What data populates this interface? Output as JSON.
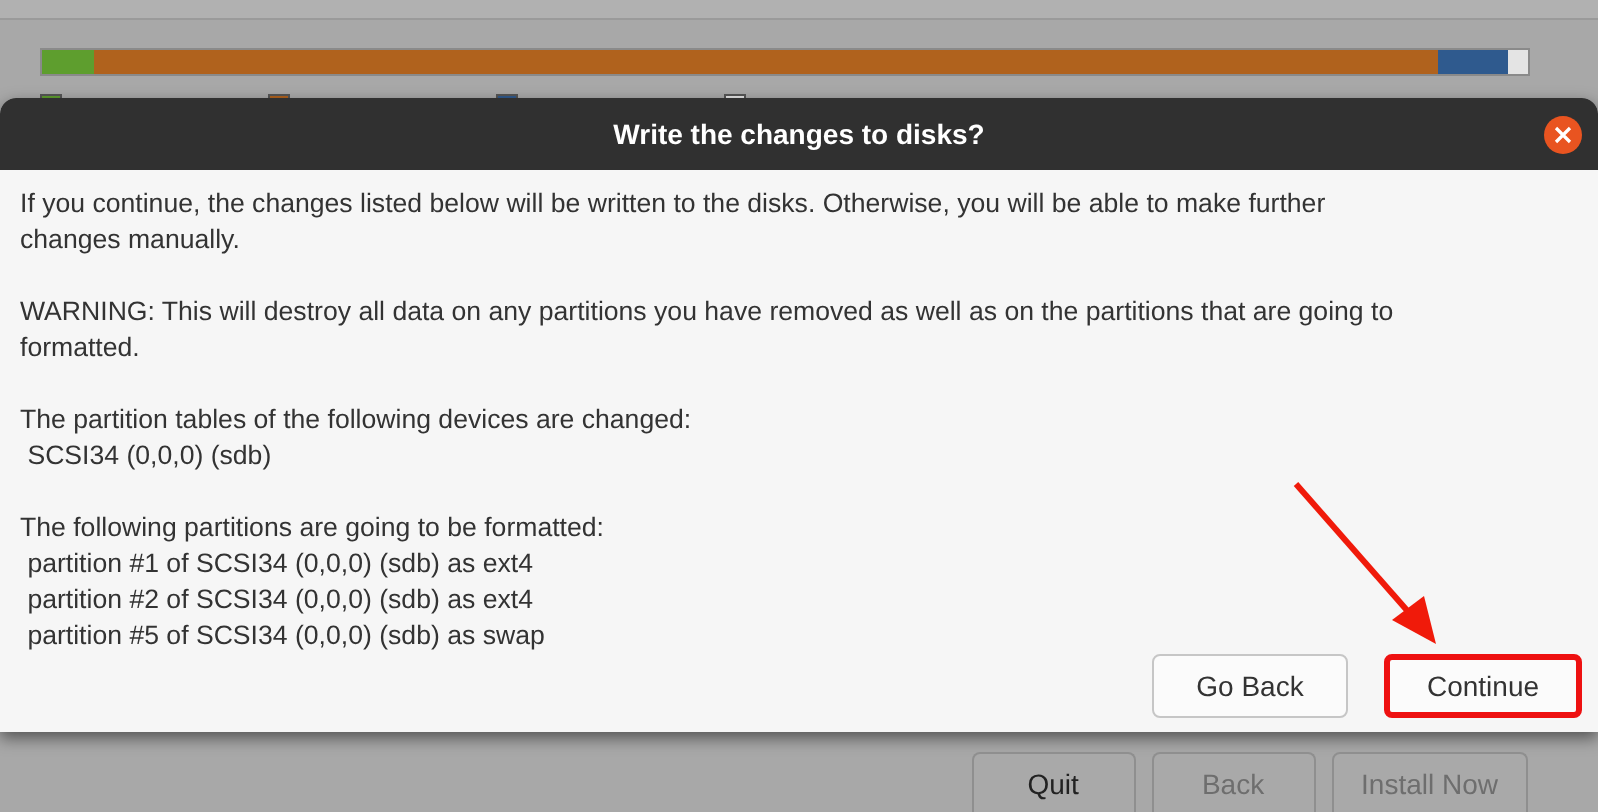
{
  "partition_bar": {
    "segments": [
      {
        "color": "#5e9e2e"
      },
      {
        "color": "#b0621d"
      },
      {
        "color": "#2f5a8e"
      },
      {
        "color": "#e4e4e4"
      }
    ]
  },
  "dialog": {
    "title": "Write the changes to disks?",
    "paragraphs": [
      [
        "If you continue, the changes listed below will be written to the disks. Otherwise, you will be able to make further",
        "changes manually."
      ],
      [
        "WARNING: This will destroy all data on any partitions you have removed as well as on the partitions that are going to",
        "formatted."
      ],
      [
        "The partition tables of the following devices are changed:",
        " SCSI34 (0,0,0) (sdb)"
      ],
      [
        "The following partitions are going to be formatted:",
        " partition #1 of SCSI34 (0,0,0) (sdb) as ext4",
        " partition #2 of SCSI34 (0,0,0) (sdb) as ext4",
        " partition #5 of SCSI34 (0,0,0) (sdb) as swap"
      ]
    ],
    "buttons": [
      {
        "label": "Go Back",
        "highlighted": false
      },
      {
        "label": "Continue",
        "highlighted": true
      }
    ]
  },
  "footer_buttons": [
    {
      "label": "Quit",
      "disabled": false
    },
    {
      "label": "Back",
      "disabled": true
    },
    {
      "label": "Install Now",
      "disabled": true
    }
  ]
}
